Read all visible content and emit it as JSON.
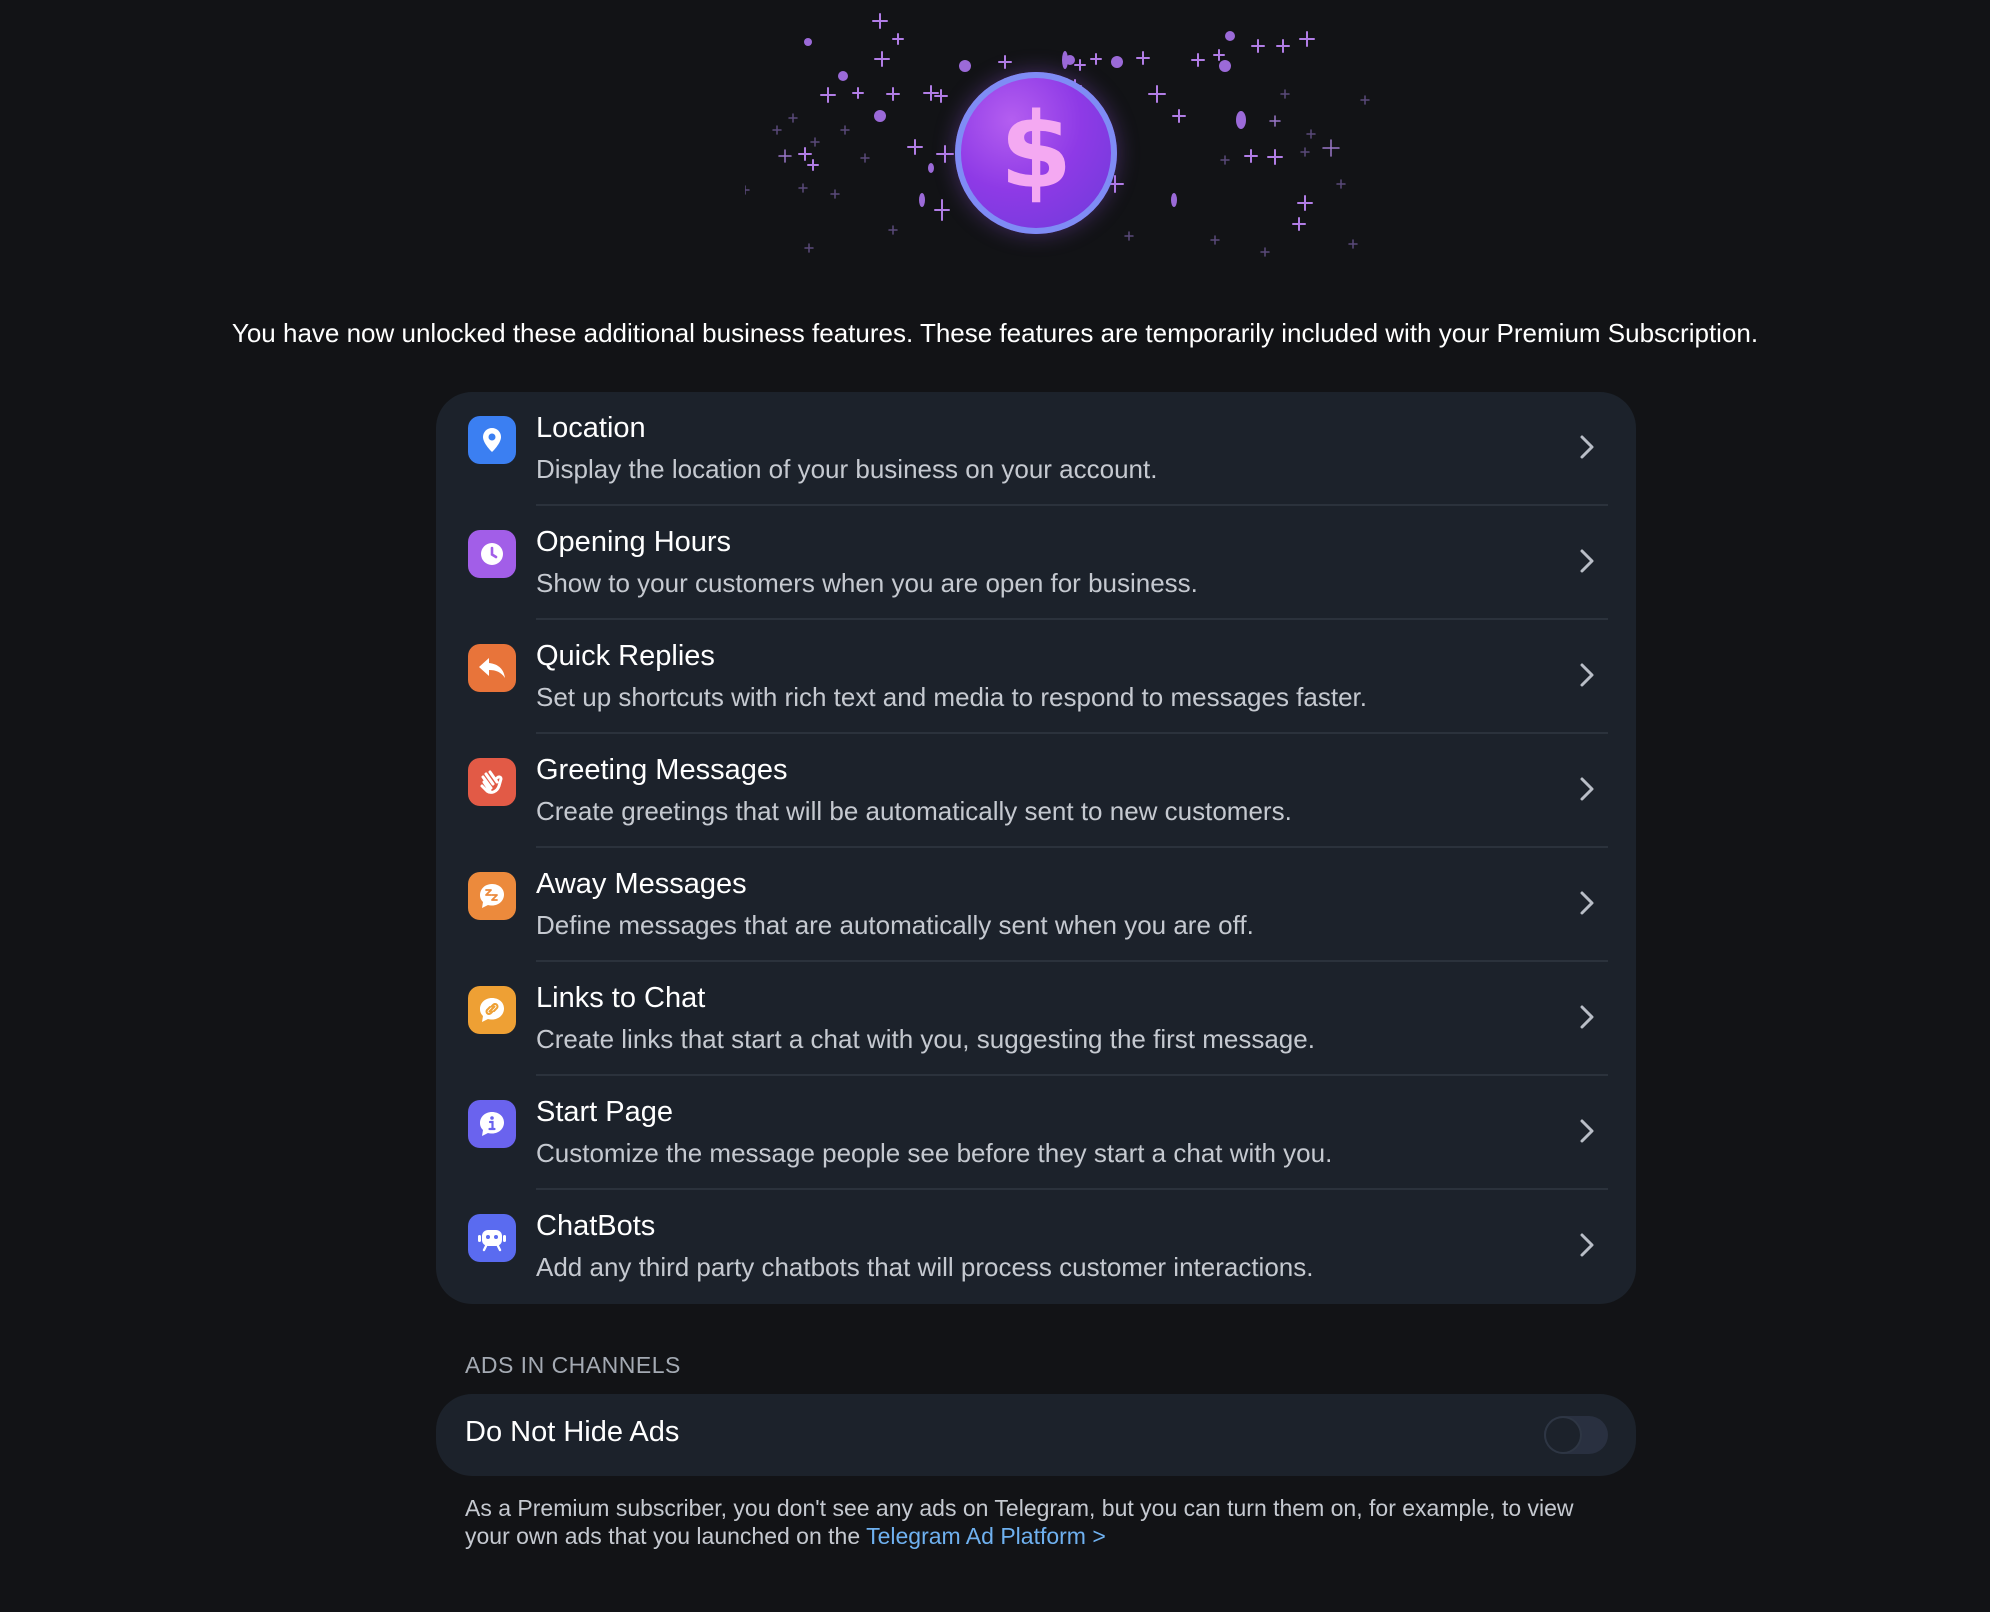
{
  "intro_text": "You have now unlocked these additional business features. These features are temporarily included with your Premium Subscription.",
  "hero": {
    "symbol": "$",
    "icon": "premium-coin-icon"
  },
  "features": [
    {
      "icon": "location-pin-icon",
      "color": "#3b7ff2",
      "title": "Location",
      "description": "Display the location of your business on your account."
    },
    {
      "icon": "clock-icon",
      "color": "#a25ee8",
      "title": "Opening Hours",
      "description": "Show to your customers when you are open for business."
    },
    {
      "icon": "reply-arrow-icon",
      "color": "#e8743a",
      "title": "Quick Replies",
      "description": "Set up shortcuts with rich text and media to respond to messages faster."
    },
    {
      "icon": "waving-hand-icon",
      "color": "#e25a46",
      "title": "Greeting Messages",
      "description": "Create greetings that will be automatically sent to new customers."
    },
    {
      "icon": "sleep-bubble-icon",
      "color": "#ec8a3c",
      "title": "Away Messages",
      "description": "Define messages that are automatically sent when you are off."
    },
    {
      "icon": "link-bubble-icon",
      "color": "#eea034",
      "title": "Links to Chat",
      "description": "Create links that start a chat with you, suggesting the first message."
    },
    {
      "icon": "info-bubble-icon",
      "color": "#6a63ee",
      "title": "Start Page",
      "description": "Customize the message people see before they start a chat with you."
    },
    {
      "icon": "robot-icon",
      "color": "#5a6bf0",
      "title": "ChatBots",
      "description": "Add any third party chatbots that will process customer interactions."
    }
  ],
  "ads_section": {
    "header": "ADS IN CHANNELS",
    "toggle_label": "Do Not Hide Ads",
    "toggle_on": false,
    "footnote_text": "As a Premium subscriber, you don't see any ads on Telegram, but you can turn them on, for example, to view your own ads that you launched on the ",
    "footnote_link": "Telegram Ad Platform >"
  },
  "colors": {
    "background": "#121316",
    "card": "#1c222b",
    "link": "#6fb1f0",
    "accent_purple": "#8e3ae6"
  }
}
